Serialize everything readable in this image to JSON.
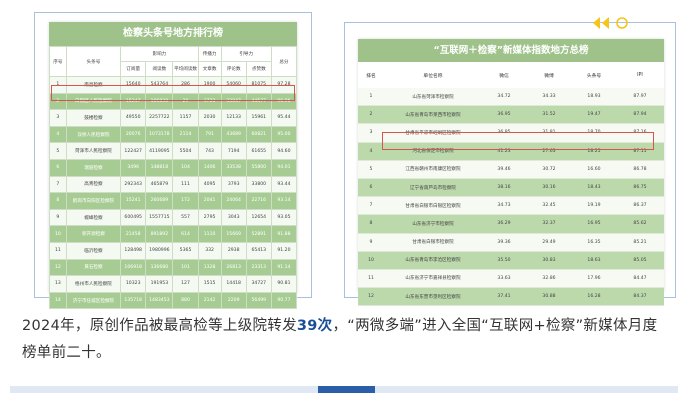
{
  "left_table": {
    "title": "检察头条号地方排行榜",
    "group_headers": [
      "影响力",
      "传播力",
      "引导力"
    ],
    "columns": [
      "序号",
      "头条号",
      "订阅量",
      "阅读数",
      "平均阅读数",
      "文章数",
      "评论数",
      "点赞数",
      "总分"
    ],
    "rows": [
      [
        "1",
        "南昌检察",
        "15640",
        "543764",
        "286",
        "1900",
        "54060",
        "81075",
        "97.28"
      ],
      [
        "2",
        "白银区人民检察院",
        "15247",
        "106830",
        "29",
        "3723",
        "33847",
        "44577",
        "96.96"
      ],
      [
        "3",
        "鼓楼检察",
        "49550",
        "2257722",
        "1157",
        "2030",
        "12133",
        "15961",
        "95.44"
      ],
      [
        "4",
        "双桥人民检察院",
        "20076",
        "1073178",
        "2114",
        "791",
        "43689",
        "60821",
        "95.00"
      ],
      [
        "5",
        "菏泽市人民检察院",
        "122427",
        "4119095",
        "5504",
        "743",
        "7194",
        "61655",
        "94.60"
      ],
      [
        "6",
        "瑞丽检察",
        "3496",
        "148818",
        "104",
        "1406",
        "33538",
        "55800",
        "94.01"
      ],
      [
        "7",
        "高青检察",
        "292343",
        "465879",
        "111",
        "4095",
        "3793",
        "33800",
        "93.44"
      ],
      [
        "8",
        "鹤岗市向阳区检察院",
        "15241",
        "260689",
        "172",
        "2041",
        "24064",
        "22716",
        "93.14"
      ],
      [
        "9",
        "椒峰检察",
        "600495",
        "1557715",
        "557",
        "2795",
        "3043",
        "12654",
        "93.05"
      ],
      [
        "10",
        "新开源检察",
        "21458",
        "891892",
        "614",
        "1110",
        "15669",
        "52891",
        "91.88"
      ],
      [
        "11",
        "临沂检察",
        "128498",
        "1980996",
        "5365",
        "332",
        "2938",
        "65413",
        "91.20"
      ],
      [
        "12",
        "黄石检察",
        "106918",
        "136680",
        "101",
        "1328",
        "26813",
        "23313",
        "91.14"
      ],
      [
        "13",
        "梧州市人民检察院",
        "10323",
        "191953",
        "127",
        "1515",
        "14418",
        "34727",
        "90.81"
      ],
      [
        "14",
        "济宁市任城区检察院",
        "135718",
        "1483453",
        "880",
        "2142",
        "2209",
        "56499",
        "90.77"
      ]
    ]
  },
  "right_table": {
    "title": "“互联网＋检察”新媒体指数地方总榜",
    "columns": [
      "排名",
      "单位名称",
      "微信",
      "微博",
      "头条号",
      "IPI"
    ],
    "rows": [
      [
        "1",
        "山东省菏泽市检察院",
        "34.72",
        "34.33",
        "18.93",
        "87.97"
      ],
      [
        "2",
        "山东省青岛市莱西市检察院",
        "36.95",
        "31.52",
        "19.47",
        "87.94"
      ],
      [
        "3",
        "甘肃省平凉市崆峒区检察院",
        "36.85",
        "31.81",
        "18.70",
        "87.16"
      ],
      [
        "4",
        "河北省保定市检察院",
        "41.23",
        "27.63",
        "18.25",
        "87.11"
      ],
      [
        "5",
        "江西省赣州市南康区检察院",
        "39.46",
        "30.72",
        "16.60",
        "86.78"
      ],
      [
        "6",
        "辽宁省葫芦岛市检察院",
        "38.16",
        "30.16",
        "18.43",
        "86.75"
      ],
      [
        "7",
        "甘肃省白银市白银区检察院",
        "34.73",
        "32.45",
        "19.19",
        "86.37"
      ],
      [
        "8",
        "山东省济宁市检察院",
        "36.29",
        "32.37",
        "16.95",
        "85.62"
      ],
      [
        "9",
        "甘肃省白银市检察院",
        "39.36",
        "29.49",
        "16.35",
        "85.21"
      ],
      [
        "10",
        "山东省青岛市李沧区检察院",
        "35.50",
        "30.83",
        "18.63",
        "85.05"
      ],
      [
        "11",
        "山东省济宁市嘉祥县检察院",
        "33.63",
        "32.86",
        "17.96",
        "84.47"
      ],
      [
        "12",
        "山东省东营市垦利区检察院",
        "37.41",
        "30.88",
        "16.28",
        "84.37"
      ]
    ]
  },
  "caption": {
    "part1": "2024年，原创作品被最高检等上级院转发",
    "bold": "39次",
    "part2": "，“两微多端”进入全国“互联网+检察”新媒体月度榜单前二十。"
  },
  "colors": {
    "accent": "#2a5ea8",
    "table_green": "#9ec28a",
    "highlight": "#d9534f",
    "deco": "#f5c518"
  }
}
